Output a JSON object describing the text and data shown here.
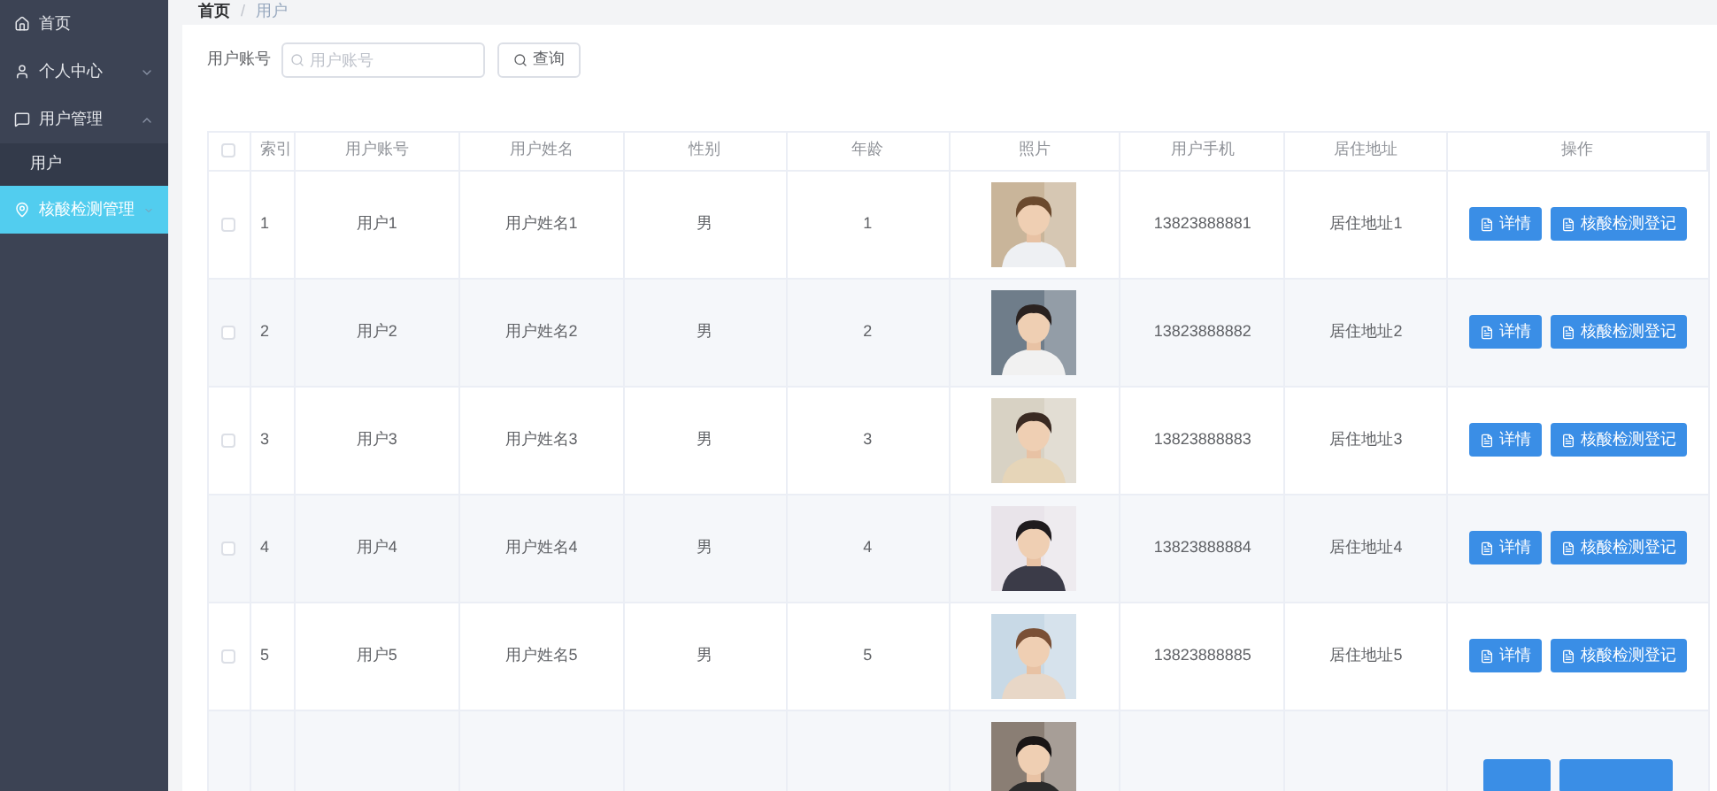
{
  "sidebar": {
    "items": [
      {
        "label": "首页",
        "kind": "home",
        "selected": false
      },
      {
        "label": "个人中心",
        "kind": "user",
        "selected": false,
        "expanded": false
      },
      {
        "label": "用户管理",
        "kind": "chat",
        "selected": false,
        "expanded": true,
        "children": [
          {
            "label": "用户",
            "selected": false
          }
        ]
      },
      {
        "label": "核酸检测管理",
        "kind": "pin",
        "selected": true,
        "expanded": false
      }
    ]
  },
  "breadcrumb": {
    "separator": "/",
    "items": [
      "首页",
      "用户"
    ]
  },
  "search": {
    "label": "用户账号",
    "placeholder": "用户账号",
    "button": "查询"
  },
  "table": {
    "all_checked": false,
    "columns": [
      "索引",
      "用户账号",
      "用户姓名",
      "性别",
      "年龄",
      "照片",
      "用户手机",
      "居住地址",
      "操作"
    ],
    "rows": [
      {
        "kind": "full",
        "checked": false,
        "cells": [
          "1",
          "用户1",
          "用户姓名1",
          "男",
          "1"
        ],
        "phone": "13823888881",
        "address": "居住地址1",
        "actions": [
          "详情",
          "核酸检测登记"
        ]
      },
      {
        "kind": "full",
        "checked": false,
        "cells": [
          "2",
          "用户2",
          "用户姓名2",
          "男",
          "2"
        ],
        "phone": "13823888882",
        "address": "居住地址2",
        "actions": [
          "详情",
          "核酸检测登记"
        ]
      },
      {
        "kind": "full",
        "checked": false,
        "cells": [
          "3",
          "用户3",
          "用户姓名3",
          "男",
          "3"
        ],
        "phone": "13823888883",
        "address": "居住地址3",
        "actions": [
          "详情",
          "核酸检测登记"
        ]
      },
      {
        "kind": "full",
        "checked": false,
        "cells": [
          "4",
          "用户4",
          "用户姓名4",
          "男",
          "4"
        ],
        "phone": "13823888884",
        "address": "居住地址4",
        "actions": [
          "详情",
          "核酸检测登记"
        ]
      },
      {
        "kind": "full",
        "checked": false,
        "cells": [
          "5",
          "用户5",
          "用户姓名5",
          "男",
          "5"
        ],
        "phone": "13823888885",
        "address": "居住地址5",
        "actions": [
          "详情",
          "核酸检测登记"
        ]
      },
      {
        "kind": "cut"
      }
    ]
  }
}
